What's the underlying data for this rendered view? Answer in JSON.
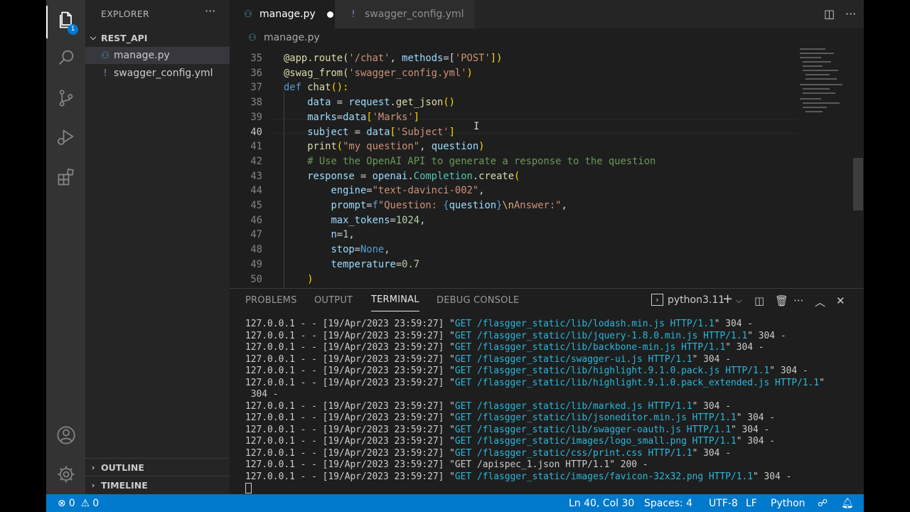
{
  "activity_bar": {
    "explorer_badge": "1"
  },
  "sidebar": {
    "title": "EXPLORER",
    "more": "···",
    "folder": "REST_API",
    "files": [
      {
        "name": "manage.py",
        "icon": "python-icon"
      },
      {
        "name": "swagger_config.yml",
        "icon": "yaml-icon"
      }
    ],
    "outline": "OUTLINE",
    "timeline": "TIMELINE"
  },
  "tabs": [
    {
      "label": "manage.py",
      "icon": "python-icon",
      "active": true,
      "dirty": true
    },
    {
      "label": "swagger_config.yml",
      "icon": "yaml-icon",
      "active": false
    }
  ],
  "breadcrumb": "manage.py",
  "code": {
    "current_line": 40,
    "lines": [
      {
        "n": "35",
        "tokens": [
          [
            "@app.route(",
            "#dcdcaa"
          ],
          [
            "'/chat'",
            "#ce9178"
          ],
          [
            ", ",
            "#d4d4d4"
          ],
          [
            "methods",
            "#9cdcfe"
          ],
          [
            "=[",
            "#d4d4d4"
          ],
          [
            "'POST'",
            "#ce9178"
          ],
          [
            "])",
            "#ffd700"
          ]
        ]
      },
      {
        "n": "36",
        "tokens": [
          [
            "@swag_from(",
            "#dcdcaa"
          ],
          [
            "'swagger_config.yml'",
            "#ce9178"
          ],
          [
            ")",
            "#ffd700"
          ]
        ]
      },
      {
        "n": "37",
        "tokens": [
          [
            "def ",
            "#569cd6"
          ],
          [
            "chat",
            "#dcdcaa"
          ],
          [
            "():",
            "#ffd700"
          ]
        ]
      },
      {
        "n": "38",
        "tokens": [
          [
            "    data ",
            "#9cdcfe"
          ],
          [
            "= ",
            "#d4d4d4"
          ],
          [
            "request",
            "#9cdcfe"
          ],
          [
            ".",
            "#d4d4d4"
          ],
          [
            "get_json",
            "#dcdcaa"
          ],
          [
            "()",
            "#ffd700"
          ]
        ]
      },
      {
        "n": "39",
        "tokens": [
          [
            "    marks",
            "#9cdcfe"
          ],
          [
            "=",
            "#d4d4d4"
          ],
          [
            "data",
            "#9cdcfe"
          ],
          [
            "[",
            "#ffd700"
          ],
          [
            "'Marks'",
            "#ce9178"
          ],
          [
            "]",
            "#ffd700"
          ]
        ]
      },
      {
        "n": "40",
        "tokens": [
          [
            "    subject ",
            "#9cdcfe"
          ],
          [
            "= ",
            "#d4d4d4"
          ],
          [
            "data",
            "#9cdcfe"
          ],
          [
            "[",
            "#ffd700"
          ],
          [
            "'Subject'",
            "#ce9178"
          ],
          [
            "]",
            "#ffd700"
          ]
        ]
      },
      {
        "n": "41",
        "tokens": [
          [
            "    print",
            "#dcdcaa"
          ],
          [
            "(",
            "#ffd700"
          ],
          [
            "\"my question\"",
            "#ce9178"
          ],
          [
            ", ",
            "#d4d4d4"
          ],
          [
            "question",
            "#9cdcfe"
          ],
          [
            ")",
            "#ffd700"
          ]
        ]
      },
      {
        "n": "42",
        "tokens": [
          [
            "    # Use the OpenAI API to generate a response to the question",
            "#6a9955"
          ]
        ]
      },
      {
        "n": "43",
        "tokens": [
          [
            "    response ",
            "#9cdcfe"
          ],
          [
            "= ",
            "#d4d4d4"
          ],
          [
            "openai",
            "#9cdcfe"
          ],
          [
            ".",
            "#d4d4d4"
          ],
          [
            "Completion",
            "#4ec9b0"
          ],
          [
            ".",
            "#d4d4d4"
          ],
          [
            "create",
            "#dcdcaa"
          ],
          [
            "(",
            "#ffd700"
          ]
        ]
      },
      {
        "n": "44",
        "tokens": [
          [
            "        engine",
            "#9cdcfe"
          ],
          [
            "=",
            "#d4d4d4"
          ],
          [
            "\"text-davinci-002\"",
            "#ce9178"
          ],
          [
            ",",
            "#d4d4d4"
          ]
        ]
      },
      {
        "n": "45",
        "tokens": [
          [
            "        prompt",
            "#9cdcfe"
          ],
          [
            "=",
            "#d4d4d4"
          ],
          [
            "f",
            "#569cd6"
          ],
          [
            "\"Question: ",
            "#ce9178"
          ],
          [
            "{",
            "#569cd6"
          ],
          [
            "question",
            "#9cdcfe"
          ],
          [
            "}",
            "#569cd6"
          ],
          [
            "\\n",
            "#d7ba7d"
          ],
          [
            "Answer:\"",
            "#ce9178"
          ],
          [
            ",",
            "#d4d4d4"
          ]
        ]
      },
      {
        "n": "46",
        "tokens": [
          [
            "        max_tokens",
            "#9cdcfe"
          ],
          [
            "=",
            "#d4d4d4"
          ],
          [
            "1024",
            "#b5cea8"
          ],
          [
            ",",
            "#d4d4d4"
          ]
        ]
      },
      {
        "n": "47",
        "tokens": [
          [
            "        n",
            "#9cdcfe"
          ],
          [
            "=",
            "#d4d4d4"
          ],
          [
            "1",
            "#b5cea8"
          ],
          [
            ",",
            "#d4d4d4"
          ]
        ]
      },
      {
        "n": "48",
        "tokens": [
          [
            "        stop",
            "#9cdcfe"
          ],
          [
            "=",
            "#d4d4d4"
          ],
          [
            "None",
            "#569cd6"
          ],
          [
            ",",
            "#d4d4d4"
          ]
        ]
      },
      {
        "n": "49",
        "tokens": [
          [
            "        temperature",
            "#9cdcfe"
          ],
          [
            "=",
            "#d4d4d4"
          ],
          [
            "0.7",
            "#b5cea8"
          ]
        ]
      },
      {
        "n": "50",
        "tokens": [
          [
            "    )",
            "#ffd700"
          ]
        ]
      }
    ]
  },
  "panel": {
    "tabs": [
      "PROBLEMS",
      "OUTPUT",
      "TERMINAL",
      "DEBUG CONSOLE"
    ],
    "active_tab": "TERMINAL",
    "shell": "python3.11",
    "terminal_lines": [
      {
        "prefix": "127.0.0.1 - - [19/Apr/2023 23:59:27] \"",
        "get": "GET /flasgger_static/lib/lodash.min.js HTTP/1.1",
        "suffix": "\" 304 -"
      },
      {
        "prefix": "127.0.0.1 - - [19/Apr/2023 23:59:27] \"",
        "get": "GET /flasgger_static/lib/jquery-1.8.0.min.js HTTP/1.1",
        "suffix": "\" 304 -"
      },
      {
        "prefix": "127.0.0.1 - - [19/Apr/2023 23:59:27] \"",
        "get": "GET /flasgger_static/lib/backbone-min.js HTTP/1.1",
        "suffix": "\" 304 -"
      },
      {
        "prefix": "127.0.0.1 - - [19/Apr/2023 23:59:27] \"",
        "get": "GET /flasgger_static/swagger-ui.js HTTP/1.1",
        "suffix": "\" 304 -"
      },
      {
        "prefix": "127.0.0.1 - - [19/Apr/2023 23:59:27] \"",
        "get": "GET /flasgger_static/lib/highlight.9.1.0.pack.js HTTP/1.1",
        "suffix": "\" 304 -"
      },
      {
        "prefix": "127.0.0.1 - - [19/Apr/2023 23:59:27] \"",
        "get": "GET /flasgger_static/lib/highlight.9.1.0.pack_extended.js HTTP/1.1",
        "suffix": "\""
      },
      {
        "prefix": " 304 -",
        "get": "",
        "suffix": ""
      },
      {
        "prefix": "127.0.0.1 - - [19/Apr/2023 23:59:27] \"",
        "get": "GET /flasgger_static/lib/marked.js HTTP/1.1",
        "suffix": "\" 304 -"
      },
      {
        "prefix": "127.0.0.1 - - [19/Apr/2023 23:59:27] \"",
        "get": "GET /flasgger_static/lib/jsoneditor.min.js HTTP/1.1",
        "suffix": "\" 304 -"
      },
      {
        "prefix": "127.0.0.1 - - [19/Apr/2023 23:59:27] \"",
        "get": "GET /flasgger_static/lib/swagger-oauth.js HTTP/1.1",
        "suffix": "\" 304 -"
      },
      {
        "prefix": "127.0.0.1 - - [19/Apr/2023 23:59:27] \"",
        "get": "GET /flasgger_static/images/logo_small.png HTTP/1.1",
        "suffix": "\" 304 -"
      },
      {
        "prefix": "127.0.0.1 - - [19/Apr/2023 23:59:27] \"",
        "get": "GET /flasgger_static/css/print.css HTTP/1.1",
        "suffix": "\" 304 -"
      },
      {
        "prefix": "127.0.0.1 - - [19/Apr/2023 23:59:27] \"GET /apispec_1.json HTTP/1.1\" 200 -",
        "get": "",
        "suffix": ""
      },
      {
        "prefix": "127.0.0.1 - - [19/Apr/2023 23:59:27] \"",
        "get": "GET /flasgger_static/images/favicon-32x32.png HTTP/1.1",
        "suffix": "\" 304 -"
      }
    ]
  },
  "status": {
    "errors": "0",
    "warnings": "0",
    "position": "Ln 40, Col 30",
    "spaces": "Spaces: 4",
    "encoding": "UTF-8",
    "eol": "LF",
    "language": "Python"
  }
}
